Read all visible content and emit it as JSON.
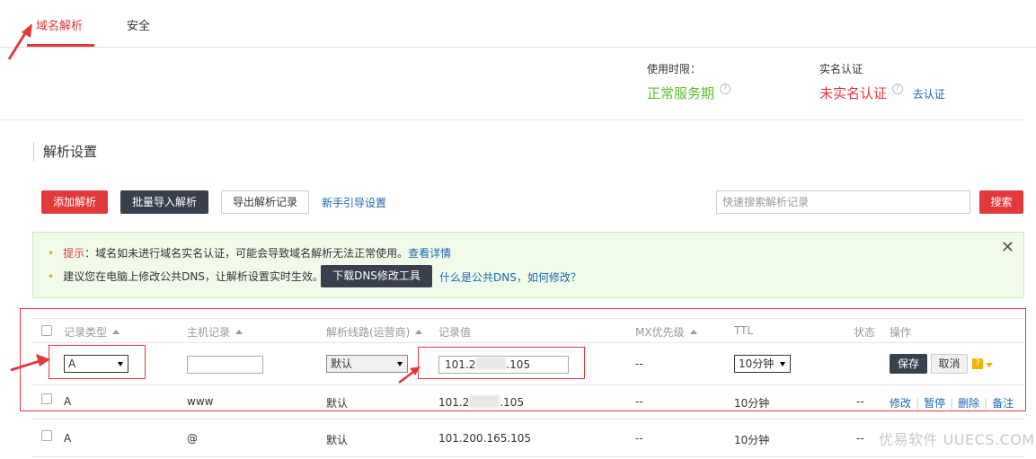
{
  "tabs": [
    {
      "label": "域名解析",
      "active": true
    },
    {
      "label": "安全",
      "active": false
    }
  ],
  "service": {
    "label": "使用时限：",
    "value": "正常服务期",
    "color": "#5bbd2b"
  },
  "realname": {
    "label": "实名认证",
    "value": "未实名认证",
    "color": "#e4393c",
    "link": "去认证"
  },
  "section_title": "解析设置",
  "toolbar": {
    "add": "添加解析",
    "batch_import": "批量导入解析",
    "export": "导出解析记录",
    "guide": "新手引导设置",
    "search_placeholder": "快速搜索解析记录",
    "search_button": "搜索"
  },
  "notice": {
    "line1_prefix": "提示",
    "line1_text": "：域名如未进行域名实名认证，可能会导致域名解析无法正常使用。",
    "line1_link": "查看详情",
    "line2_text": "建议您在电脑上修改公共DNS，让解析设置实时生效。",
    "line2_button": "下载DNS修改工具",
    "line2_link": "什么是公共DNS，如何修改？",
    "close": "✕"
  },
  "table": {
    "headers": {
      "type": "记录类型",
      "host": "主机记录",
      "line": "解析线路(运营商)",
      "value": "记录值",
      "mx": "MX优先级",
      "ttl": "TTL",
      "status": "状态",
      "ops": "操作"
    },
    "edit_row": {
      "type": "A",
      "host": "",
      "line": "默认",
      "value_prefix": "101.2",
      "value_suffix": ".105",
      "mx": "--",
      "ttl": "10分钟",
      "save": "保存",
      "cancel": "取消",
      "help": "?"
    },
    "rows": [
      {
        "type": "A",
        "host": "www",
        "line": "默认",
        "value_prefix": "101.2",
        "value_suffix": ".105",
        "mx": "--",
        "ttl": "10分钟",
        "status": "--",
        "ops": [
          "修改",
          "暂停",
          "删除",
          "备注"
        ]
      },
      {
        "type": "A",
        "host": "@",
        "line": "默认",
        "value": "101.200.165.105",
        "mx": "--",
        "ttl": "10分钟",
        "status": "--"
      }
    ]
  },
  "watermark": "优易软件 UUECS.COM",
  "colors": {
    "accent": "#e4393c",
    "dark_button": "#38404d",
    "link": "#1a66b3",
    "notice_bg": "#f1fbe9"
  }
}
